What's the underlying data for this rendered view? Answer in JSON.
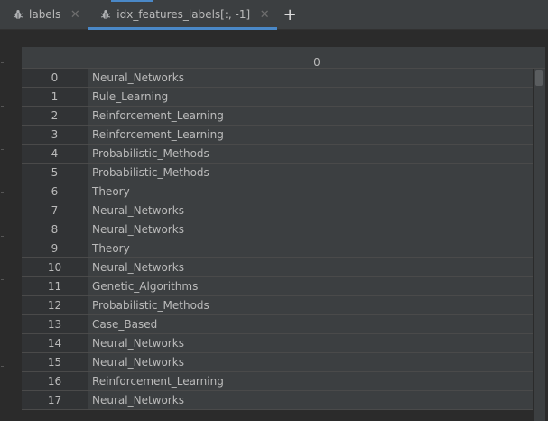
{
  "tabs": [
    {
      "label": "labels",
      "icon": "bug-icon",
      "active": false
    },
    {
      "label": "idx_features_labels[:, -1]",
      "icon": "bug-icon",
      "active": true
    }
  ],
  "add_tab_symbol": "+",
  "close_symbol": "✕",
  "table": {
    "column_header": "0",
    "rows": [
      {
        "index": "0",
        "value": "Neural_Networks"
      },
      {
        "index": "1",
        "value": "Rule_Learning"
      },
      {
        "index": "2",
        "value": "Reinforcement_Learning"
      },
      {
        "index": "3",
        "value": "Reinforcement_Learning"
      },
      {
        "index": "4",
        "value": "Probabilistic_Methods"
      },
      {
        "index": "5",
        "value": "Probabilistic_Methods"
      },
      {
        "index": "6",
        "value": "Theory"
      },
      {
        "index": "7",
        "value": "Neural_Networks"
      },
      {
        "index": "8",
        "value": "Neural_Networks"
      },
      {
        "index": "9",
        "value": "Theory"
      },
      {
        "index": "10",
        "value": "Neural_Networks"
      },
      {
        "index": "11",
        "value": "Genetic_Algorithms"
      },
      {
        "index": "12",
        "value": "Probabilistic_Methods"
      },
      {
        "index": "13",
        "value": "Case_Based"
      },
      {
        "index": "14",
        "value": "Neural_Networks"
      },
      {
        "index": "15",
        "value": "Neural_Networks"
      },
      {
        "index": "16",
        "value": "Reinforcement_Learning"
      },
      {
        "index": "17",
        "value": "Neural_Networks"
      }
    ]
  },
  "colors": {
    "accent": "#4a88c7",
    "background": "#2b2b2b",
    "cell": "#3c3f41",
    "text": "#bbbbbb"
  }
}
